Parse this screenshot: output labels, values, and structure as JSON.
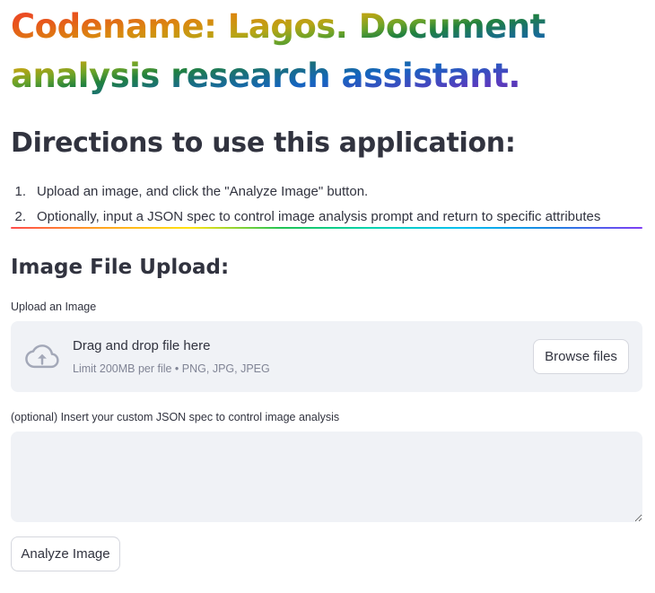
{
  "header": {
    "title": "Codename: Lagos. Document analysis research assistant."
  },
  "directions": {
    "heading": "Directions to use this application:",
    "steps": [
      {
        "num": "1.",
        "text": "Upload an image, and click the \"Analyze Image\" button."
      },
      {
        "num": "2.",
        "text": "Optionally, input a JSON spec to control image analysis prompt and return to specific attributes"
      }
    ]
  },
  "upload_section": {
    "heading": "Image File Upload:",
    "uploader_label": "Upload an Image",
    "drop_title": "Drag and drop file here",
    "drop_limits": "Limit 200MB per file • PNG, JPG, JPEG",
    "browse_label": "Browse files",
    "icon": "cloud-upload-icon"
  },
  "spec_section": {
    "label": "(optional) Insert your custom JSON spec to control image analysis",
    "value": "",
    "placeholder": ""
  },
  "actions": {
    "analyze_label": "Analyze Image"
  },
  "colors": {
    "text": "#31333f",
    "muted": "#808495",
    "panel_bg": "#f0f2f6",
    "border": "#d5d7de",
    "title_gradient": [
      "#f03c2e",
      "#d98a0f",
      "#b8a515",
      "#21813f",
      "#1565c0",
      "#5a3bbf",
      "#4b2e83"
    ]
  }
}
